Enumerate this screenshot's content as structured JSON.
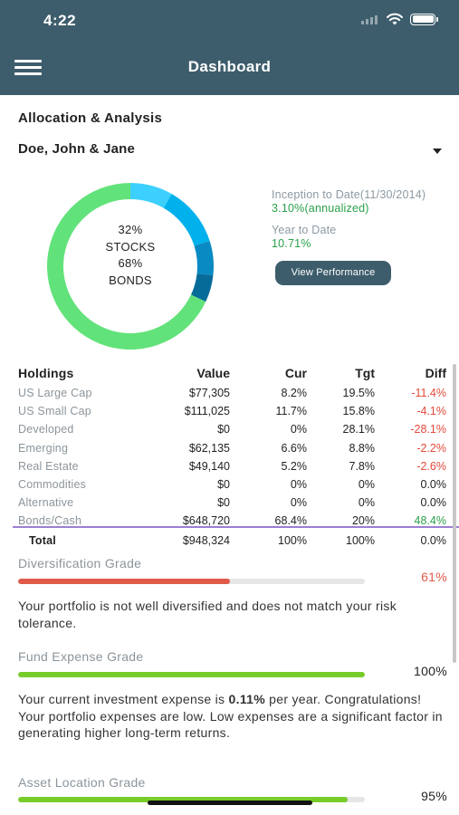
{
  "status_bar": {
    "time": "4:22"
  },
  "header": {
    "title": "Dashboard"
  },
  "section": {
    "title": "Allocation & Analysis"
  },
  "client": {
    "name": "Doe, John & Jane"
  },
  "allocation": {
    "stocks_pct": 32,
    "bonds_pct": 68,
    "center_line1": "32%",
    "center_line2": "STOCKS",
    "center_line3": "68%",
    "center_line4": "BONDS",
    "colors": {
      "bonds": "#62e27a",
      "stocks": [
        "#3cd0ff",
        "#00b1ec",
        "#0a8ac3",
        "#066b99"
      ]
    },
    "stock_segments_pct": [
      8.2,
      11.7,
      6.6,
      5.2
    ]
  },
  "performance": {
    "inception_label": "Inception to Date(11/30/2014)",
    "inception_value": "3.10%(annualized)",
    "ytd_label": "Year to Date",
    "ytd_value": "10.71%",
    "view_button": "View Performance"
  },
  "holdings": {
    "headers": {
      "name": "Holdings",
      "value": "Value",
      "cur": "Cur",
      "tgt": "Tgt",
      "diff": "Diff"
    },
    "rows": [
      {
        "name": "US Large Cap",
        "value": "$77,305",
        "cur": "8.2%",
        "tgt": "19.5%",
        "diff": "-11.4%",
        "sign": "neg"
      },
      {
        "name": "US Small Cap",
        "value": "$111,025",
        "cur": "11.7%",
        "tgt": "15.8%",
        "diff": "-4.1%",
        "sign": "neg"
      },
      {
        "name": "Developed",
        "value": "$0",
        "cur": "0%",
        "tgt": "28.1%",
        "diff": "-28.1%",
        "sign": "neg"
      },
      {
        "name": "Emerging",
        "value": "$62,135",
        "cur": "6.6%",
        "tgt": "8.8%",
        "diff": "-2.2%",
        "sign": "neg"
      },
      {
        "name": "Real Estate",
        "value": "$49,140",
        "cur": "5.2%",
        "tgt": "7.8%",
        "diff": "-2.6%",
        "sign": "neg"
      },
      {
        "name": "Commodities",
        "value": "$0",
        "cur": "0%",
        "tgt": "0%",
        "diff": "0.0%",
        "sign": "zero"
      },
      {
        "name": "Alternative",
        "value": "$0",
        "cur": "0%",
        "tgt": "0%",
        "diff": "0.0%",
        "sign": "zero"
      },
      {
        "name": "Bonds/Cash",
        "value": "$648,720",
        "cur": "68.4%",
        "tgt": "20%",
        "diff": "48.4%",
        "sign": "pos"
      }
    ],
    "total": {
      "name": "Total",
      "value": "$948,324",
      "cur": "100%",
      "tgt": "100%",
      "diff": "0.0%"
    }
  },
  "grades": {
    "diversification": {
      "title": "Diversification Grade",
      "percent": "61%",
      "fill": 0.61,
      "color": "#e05a4a",
      "text": "Your portfolio is not well diversified and does not match your risk tolerance."
    },
    "fund_expense": {
      "title": "Fund Expense Grade",
      "percent": "100%",
      "fill": 1.0,
      "color": "#77cc2a",
      "text_before": "Your current investment expense is ",
      "text_bold": "0.11%",
      "text_after": " per year. Congratulations! Your portfolio expenses are low. Low expenses are a significant factor in generating higher long-term returns."
    },
    "asset_location": {
      "title": "Asset Location Grade",
      "percent": "95%",
      "fill": 0.95,
      "color": "#77cc2a"
    }
  }
}
